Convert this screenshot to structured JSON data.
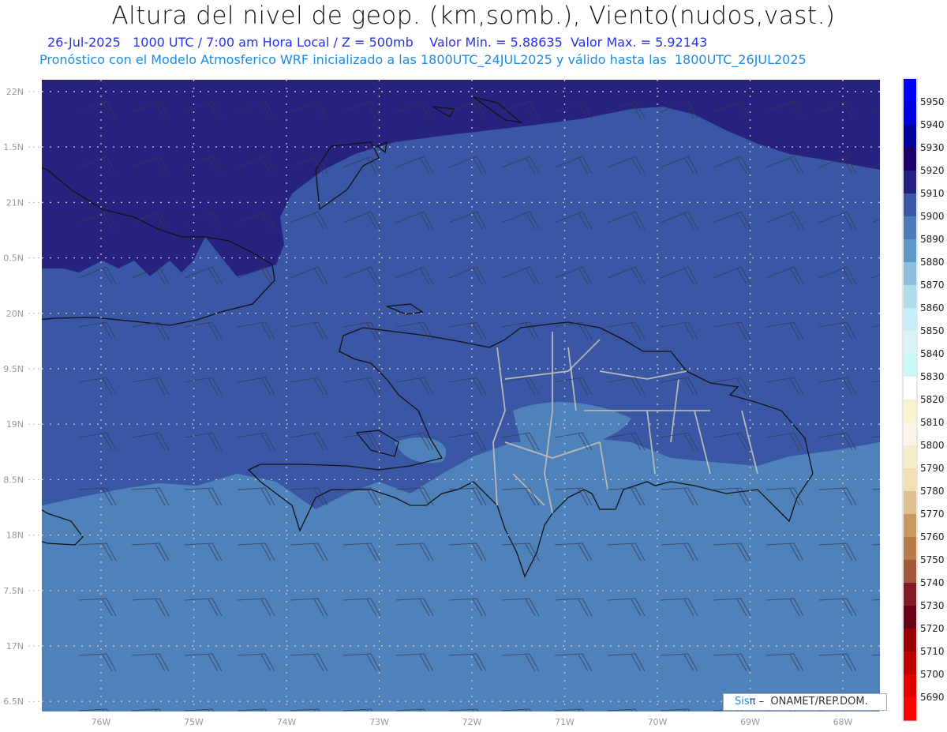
{
  "header": {
    "title": "Altura del nivel de geop. (km,somb.), Viento(nudos,vast.)",
    "subtitle_1": "26-Jul-2025   1000 UTC / 7:00 am Hora Local / Z = 500mb    Valor Min. = 5.88635  Valor Max. = 5.92143",
    "subtitle_2": "Pronóstico con el Modelo Atmosferico WRF inicializado a las 1800UTC_24JUL2025 y válido hasta las  1800UTC_26JUL2025"
  },
  "map": {
    "lat_labels": [
      "22N",
      "1.5N",
      "21N",
      "0.5N",
      "20N",
      "9.5N",
      "19N",
      "8.5N",
      "18N",
      "7.5N",
      "17N",
      "6.5N"
    ],
    "lon_labels": [
      "76W",
      "75W",
      "74W",
      "73W",
      "72W",
      "71W",
      "70W",
      "69W",
      "68W"
    ],
    "fill_colors": {
      "dark": "#27217f",
      "mid": "#3a57a5",
      "low": "#4f82bb",
      "light": "#5e98c8"
    }
  },
  "colorbar": {
    "labels": [
      "5950",
      "5940",
      "5930",
      "5920",
      "5910",
      "5900",
      "5890",
      "5880",
      "5870",
      "5860",
      "5850",
      "5840",
      "5830",
      "5820",
      "5810",
      "5800",
      "5790",
      "5780",
      "5770",
      "5760",
      "5750",
      "5740",
      "5730",
      "5720",
      "5710",
      "5700",
      "5690"
    ],
    "colors": [
      "#0000ff",
      "#0000dc",
      "#00009a",
      "#1a0068",
      "#251f82",
      "#3a56a4",
      "#4a7ab8",
      "#5e98c8",
      "#8bbfdc",
      "#b0dcea",
      "#c6eef4",
      "#dcf4f8",
      "#ccf8fa",
      "#ffffff",
      "#f8f2d0",
      "#faf5e4",
      "#f7edc6",
      "#f0e0b4",
      "#dcc090",
      "#c89860",
      "#b87c4c",
      "#a05838",
      "#841a28",
      "#6a0018",
      "#960000",
      "#c00000",
      "#e00000",
      "#ff0000"
    ]
  },
  "logo": {
    "sis": "Sis",
    "pi": "π",
    "rest": " –  ONAMET/REP.DOM."
  }
}
